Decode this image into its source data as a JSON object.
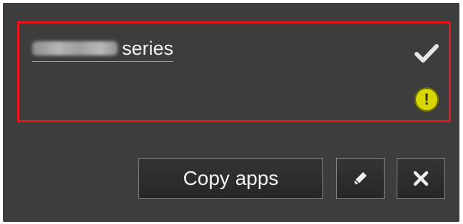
{
  "device": {
    "model_name_redacted": "MG6500",
    "series_label": "series",
    "status_icon": "checkmark-icon",
    "alert_icon": "warning-icon",
    "alert_glyph": "!"
  },
  "actions": {
    "copy_apps_label": "Copy apps",
    "edit_icon": "pencil-icon",
    "delete_icon": "close-icon"
  },
  "colors": {
    "panel_background": "#3d3d3d",
    "selection_border": "#e8141b",
    "warning": "#d6d600",
    "text": "#f2f2f2"
  }
}
